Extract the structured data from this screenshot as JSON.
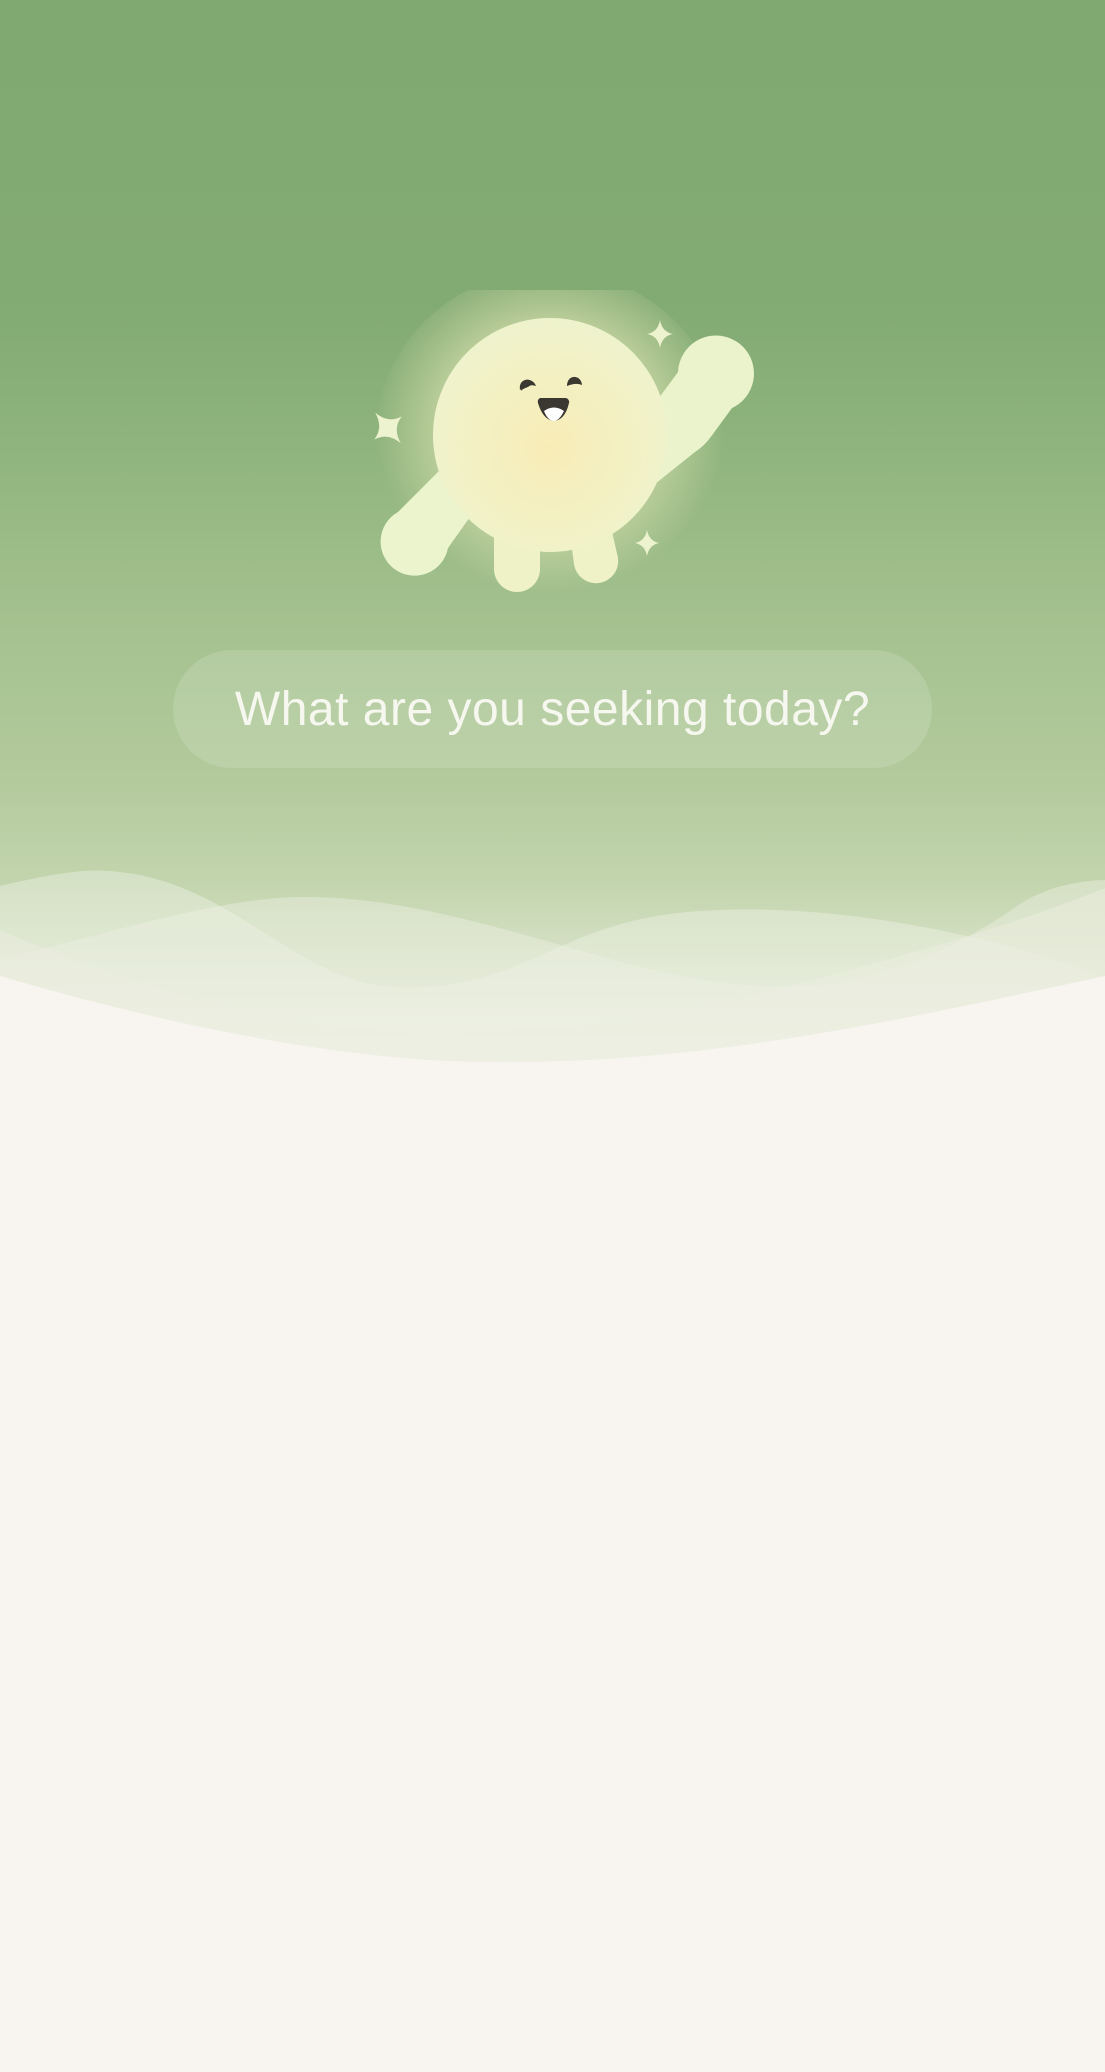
{
  "screen": {
    "prompt": {
      "text": "What are you seeking today?"
    },
    "mascot": {
      "icon": "waving-sun-mascot-icon",
      "sparkles": [
        "sparkle-icon",
        "sparkle-icon",
        "sparkle-icon"
      ]
    }
  },
  "colors": {
    "hero_top": "#80a971",
    "hero_bottom": "#c3d5ae",
    "background": "#f8f5f1",
    "mascot_body": "#f4f0bd",
    "mascot_face": "#3b3731",
    "prompt_text": "#f6f7ef"
  }
}
